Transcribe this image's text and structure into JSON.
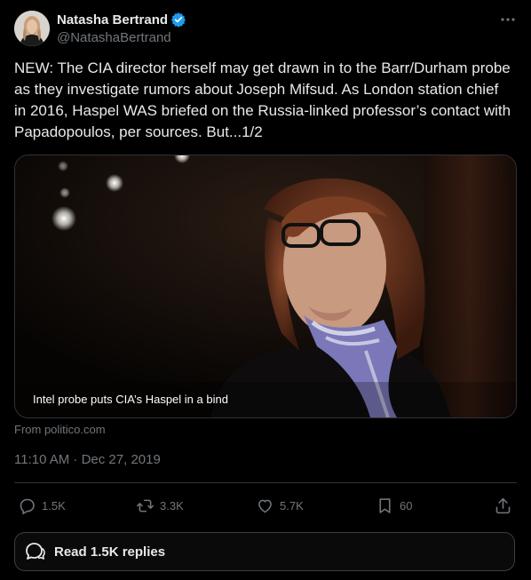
{
  "author": {
    "name": "Natasha Bertrand",
    "handle": "@NatashaBertrand",
    "verified": true
  },
  "tweet": {
    "text": "NEW: The CIA director herself may get drawn in to the Barr/Durham probe as they investigate rumors about Joseph Mifsud. As London station chief in 2016, Haspel WAS briefed on the Russia-linked professor’s contact with Papadopoulos, per sources. But...1/2",
    "timestamp": "11:10 AM · Dec 27, 2019"
  },
  "link_card": {
    "title": "Intel probe puts CIA’s Haspel in a bind",
    "source": "From politico.com"
  },
  "actions": {
    "replies": "1.5K",
    "retweets": "3.3K",
    "likes": "5.7K",
    "bookmarks": "60"
  },
  "read_replies": {
    "label": "Read 1.5K replies"
  },
  "colors": {
    "background": "#000000",
    "text": "#e7e9ea",
    "muted": "#71767b",
    "border": "#2f3336",
    "verified": "#1d9bf0"
  },
  "icons": [
    "more-icon",
    "verified-icon",
    "reply-icon",
    "retweet-icon",
    "like-icon",
    "bookmark-icon",
    "share-icon",
    "chat-bubbles-icon"
  ]
}
